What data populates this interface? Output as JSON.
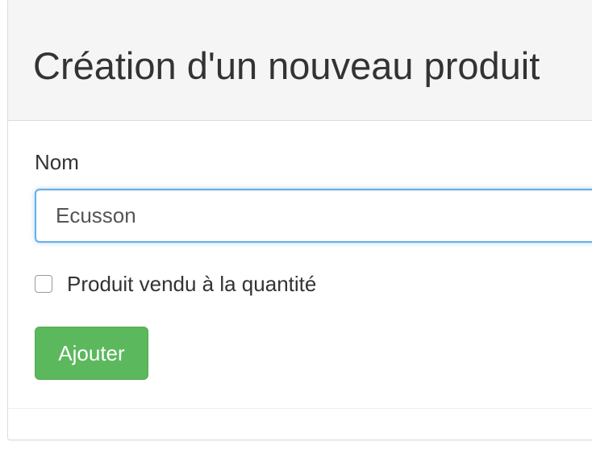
{
  "panel": {
    "title": "Création d'un nouveau produit"
  },
  "form": {
    "name_label": "Nom",
    "name_value": "Ecusson",
    "checkbox_label": "Produit vendu à la quantité",
    "checkbox_checked": false,
    "submit_label": "Ajouter"
  },
  "colors": {
    "heading_bg": "#f5f5f5",
    "focus_border": "#66afe9",
    "success_button": "#5cb85c"
  }
}
